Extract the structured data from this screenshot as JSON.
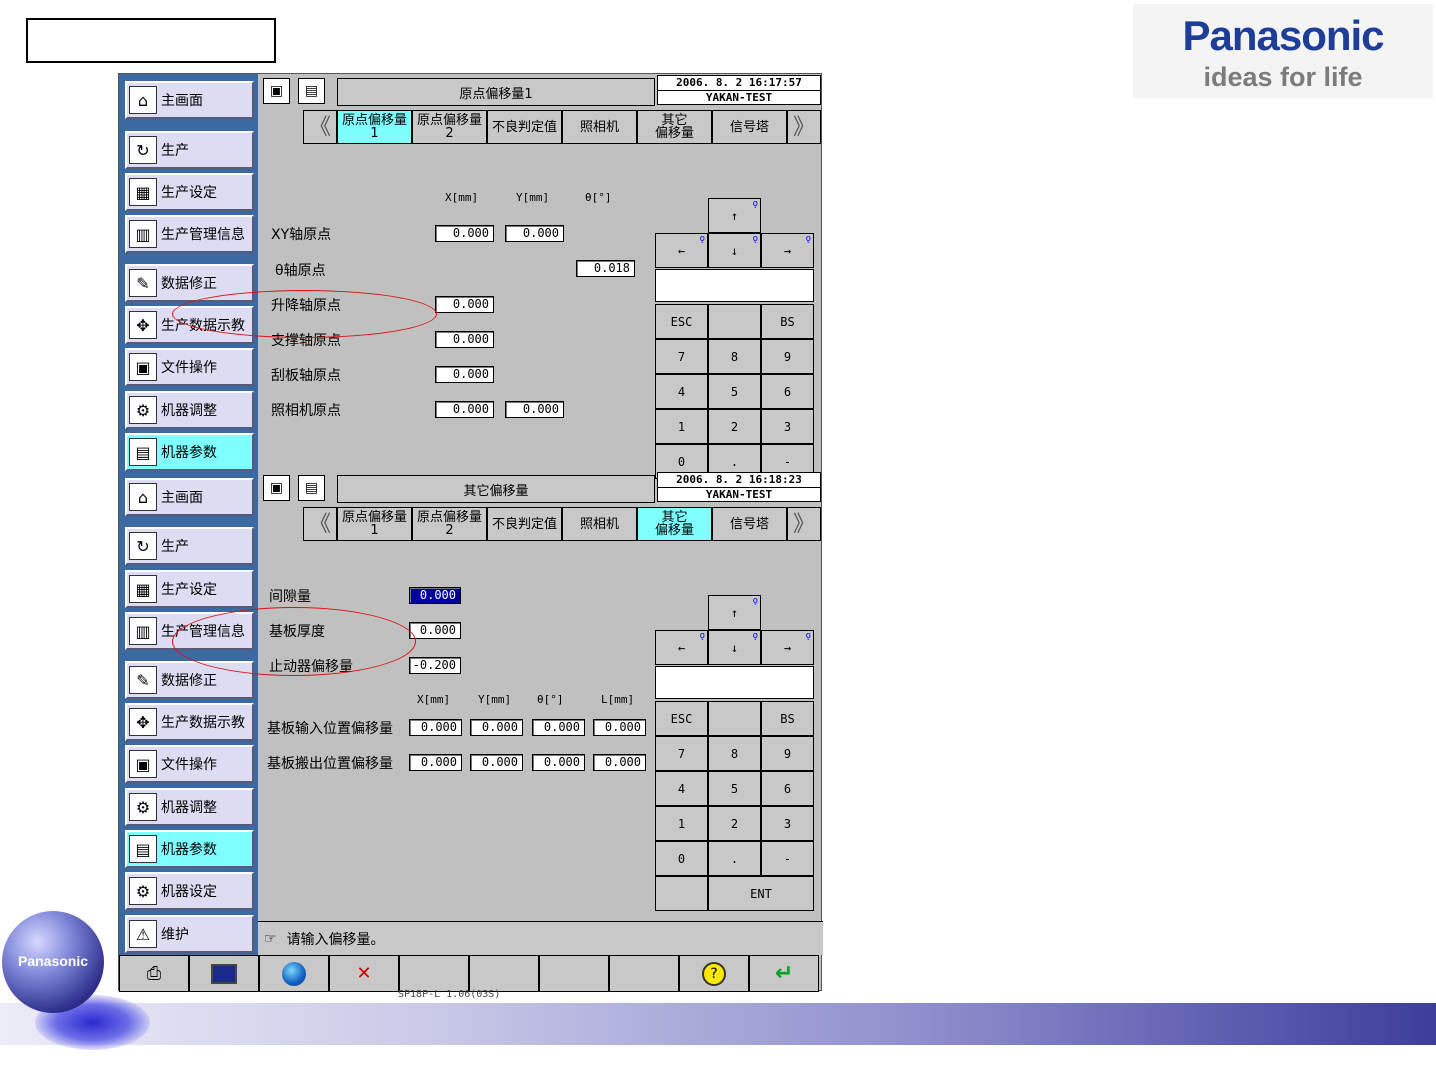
{
  "brand": {
    "name": "Panasonic",
    "slogan": "ideas for life",
    "globe_label": "Panasonic"
  },
  "sidebar_top": [
    {
      "label": "主画面",
      "icon": "home-icon",
      "active": false
    },
    {
      "label": "生产",
      "icon": "cycle-icon",
      "active": false
    },
    {
      "label": "生产设定",
      "icon": "settings-board-icon",
      "active": false
    },
    {
      "label": "生产管理信息",
      "icon": "chart-doc-icon",
      "active": false
    },
    {
      "label": "数据修正",
      "icon": "edit-pen-icon",
      "active": false
    },
    {
      "label": "生产数据示教",
      "icon": "teach-icon",
      "active": false
    },
    {
      "label": "文件操作",
      "icon": "floppy-icon",
      "active": false
    },
    {
      "label": "机器调整",
      "icon": "adjust-icon",
      "active": false
    },
    {
      "label": "机器参数",
      "icon": "param-icon",
      "active": true
    }
  ],
  "sidebar_bottom": [
    {
      "label": "主画面",
      "icon": "home-icon",
      "active": false
    },
    {
      "label": "生产",
      "icon": "cycle-icon",
      "active": false
    },
    {
      "label": "生产设定",
      "icon": "settings-board-icon",
      "active": false
    },
    {
      "label": "生产管理信息",
      "icon": "chart-doc-icon",
      "active": false
    },
    {
      "label": "数据修正",
      "icon": "edit-pen-icon",
      "active": false
    },
    {
      "label": "生产数据示教",
      "icon": "teach-icon",
      "active": false
    },
    {
      "label": "文件操作",
      "icon": "floppy-icon",
      "active": false
    },
    {
      "label": "机器调整",
      "icon": "adjust-icon",
      "active": false
    },
    {
      "label": "机器参数",
      "icon": "param-icon",
      "active": true
    },
    {
      "label": "机器设定",
      "icon": "adjust-icon",
      "active": false
    },
    {
      "label": "维护",
      "icon": "maintenance-icon",
      "active": false
    }
  ],
  "panel1": {
    "title": "原点偏移量1",
    "date": "2006. 8. 2 16:17:57",
    "machine": "YAKAN-TEST",
    "tabs": [
      {
        "label": "原点偏移量\n1",
        "active": true
      },
      {
        "label": "原点偏移量\n2",
        "active": false
      },
      {
        "label": "不良判定值",
        "active": false
      },
      {
        "label": "照相机",
        "active": false
      },
      {
        "label": "其它\n偏移量",
        "active": false
      },
      {
        "label": "信号塔",
        "active": false
      }
    ],
    "col_headers": [
      "X[mm]",
      "Y[mm]",
      "θ[°]"
    ],
    "rows": [
      {
        "label": "XY轴原点",
        "x": "0.000",
        "y": "0.000"
      },
      {
        "label": "θ轴原点",
        "theta": "0.018"
      },
      {
        "label": "升降轴原点",
        "x": "0.000"
      },
      {
        "label": "支撑轴原点",
        "x": "0.000"
      },
      {
        "label": "刮板轴原点",
        "x": "0.000"
      },
      {
        "label": "照相机原点",
        "x": "0.000",
        "y": "0.000"
      }
    ]
  },
  "panel2": {
    "title": "其它偏移量",
    "date": "2006. 8. 2 16:18:23",
    "machine": "YAKAN-TEST",
    "tabs": [
      {
        "label": "原点偏移量\n1",
        "active": false
      },
      {
        "label": "原点偏移量\n2",
        "active": false
      },
      {
        "label": "不良判定值",
        "active": false
      },
      {
        "label": "照相机",
        "active": false
      },
      {
        "label": "其它\n偏移量",
        "active": true
      },
      {
        "label": "信号塔",
        "active": false
      }
    ],
    "gap": {
      "label": "间隙量",
      "value": "0.000"
    },
    "thickness": {
      "label": "基板厚度",
      "value": "0.000"
    },
    "stopper": {
      "label": "止动器偏移量",
      "value": "-0.200"
    },
    "col_headers": [
      "X[mm]",
      "Y[mm]",
      "θ[°]",
      "L[mm]"
    ],
    "rows": [
      {
        "label": "基板输入位置偏移量",
        "values": [
          "0.000",
          "0.000",
          "0.000",
          "0.000"
        ]
      },
      {
        "label": "基板搬出位置偏移量",
        "values": [
          "0.000",
          "0.000",
          "0.000",
          "0.000"
        ]
      }
    ]
  },
  "keypad": {
    "arrows": {
      "up": "↑",
      "left": "←",
      "down": "↓",
      "right": "→"
    },
    "esc": "ESC",
    "bs": "BS",
    "ent": "ENT",
    "digits": [
      "7",
      "8",
      "9",
      "4",
      "5",
      "6",
      "1",
      "2",
      "3",
      "0",
      ".",
      "-"
    ]
  },
  "status_message": "请输入偏移量。",
  "version": "SP18P-L      1.06(03S)"
}
